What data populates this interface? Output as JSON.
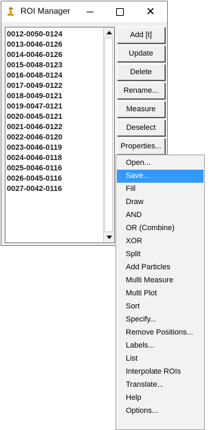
{
  "window": {
    "title": "ROI Manager",
    "controls": {
      "minimize_icon": "minimize-icon",
      "maximize_icon": "maximize-icon",
      "close_icon": "close-icon",
      "close_glyph": "✕"
    }
  },
  "roi_list": [
    "0012-0050-0124",
    "0013-0046-0126",
    "0014-0046-0126",
    "0015-0048-0123",
    "0016-0048-0124",
    "0017-0049-0122",
    "0018-0049-0121",
    "0019-0047-0121",
    "0020-0045-0121",
    "0021-0046-0122",
    "0022-0046-0120",
    "0023-0046-0119",
    "0024-0046-0118",
    "0025-0046-0116",
    "0026-0045-0116",
    "0027-0042-0116"
  ],
  "buttons": {
    "add": "Add [t]",
    "update": "Update",
    "delete": "Delete",
    "rename": "Rename...",
    "measure": "Measure",
    "deselect": "Deselect",
    "properties": "Properties..."
  },
  "menu": {
    "selected_index": 1,
    "items": [
      "Open...",
      "Save...",
      "Fill",
      "Draw",
      "AND",
      "OR (Combine)",
      "XOR",
      "Split",
      "Add Particles",
      "Multi Measure",
      "Multi Plot",
      "Sort",
      "Specify...",
      "Remove Positions...",
      "Labels...",
      "List",
      "Interpolate ROIs",
      "Translate...",
      "Help",
      "Options..."
    ]
  },
  "colors": {
    "selection": "#3399ff",
    "window_bg": "#f0f0f0",
    "icon_yellow": "#e8a317"
  }
}
